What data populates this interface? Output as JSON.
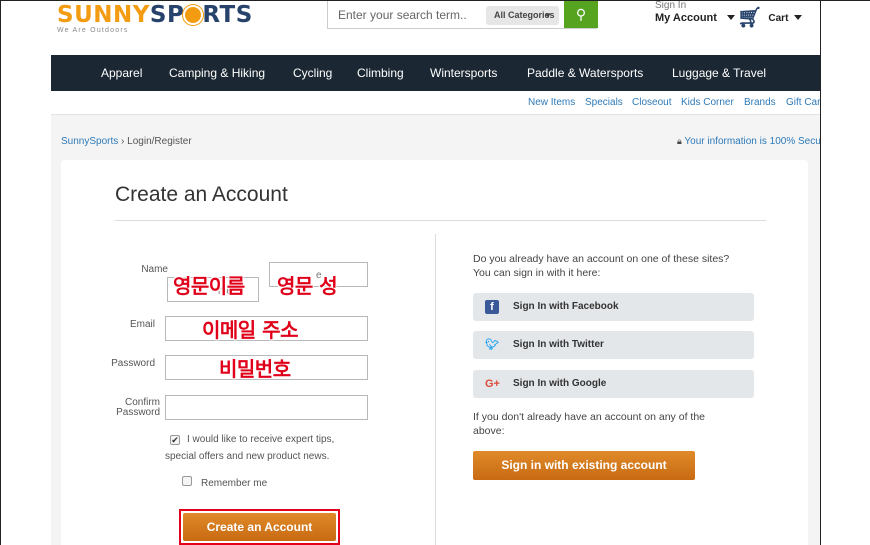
{
  "header": {
    "logo": {
      "sunny": "SUNNY",
      "sports_a": "SP",
      "sports_b": "RTS",
      "tagline": "We Are Outdoors"
    },
    "search": {
      "placeholder": "Enter your search term..",
      "category": "All Categories",
      "go_icon": "search-icon"
    },
    "account": {
      "small": "Sign In",
      "big": "My Account"
    },
    "cart": {
      "label": "Cart",
      "icon": "cart-icon"
    }
  },
  "nav": [
    "Apparel",
    "Camping & Hiking",
    "Cycling",
    "Climbing",
    "Wintersports",
    "Paddle & Watersports",
    "Luggage & Travel"
  ],
  "subnav": [
    "New Items",
    "Specials",
    "Closeout",
    "Kids Corner",
    "Brands",
    "Gift Car"
  ],
  "breadcrumb": {
    "home": "SunnySports",
    "sep": "›",
    "current": "Login/Register"
  },
  "secure_note": "Your information is 100% Secu",
  "form": {
    "title": "Create an Account",
    "name_label": "Name",
    "email_label": "Email",
    "password_label": "Password",
    "confirm_label_1": "Confirm",
    "confirm_label_2": "Password",
    "first_placeholder_fragment": "me",
    "last_placeholder_fragment": "e",
    "annotation_first": "영문이름",
    "annotation_last": "영문 성",
    "annotation_email": "이메일 주소",
    "annotation_password": "비밀번호",
    "newsletter_line1": "I would like to receive expert tips,",
    "newsletter_line2": "special offers and new product news.",
    "newsletter_checked": true,
    "remember_label": "Remember me",
    "create_button": "Create an Account",
    "highlight_color": "#e2001a"
  },
  "social": {
    "intro_line1": "Do you already have an account on one of these sites?",
    "intro_line2": "You can sign in with it here:",
    "facebook": "Sign In with Facebook",
    "twitter": "Sign In with Twitter",
    "google": "Sign In with Google",
    "google_glyph": "G+",
    "no_account_line1": "If you don't already have an account on any of the",
    "no_account_line2": "above:",
    "existing_button": "Sign in with existing account"
  },
  "colors": {
    "brand_orange": "#f39c12",
    "brand_navy": "#27436b",
    "nav_bg": "#1b2733",
    "button_orange": "#d47a1e",
    "link_blue": "#2e7ab8"
  }
}
